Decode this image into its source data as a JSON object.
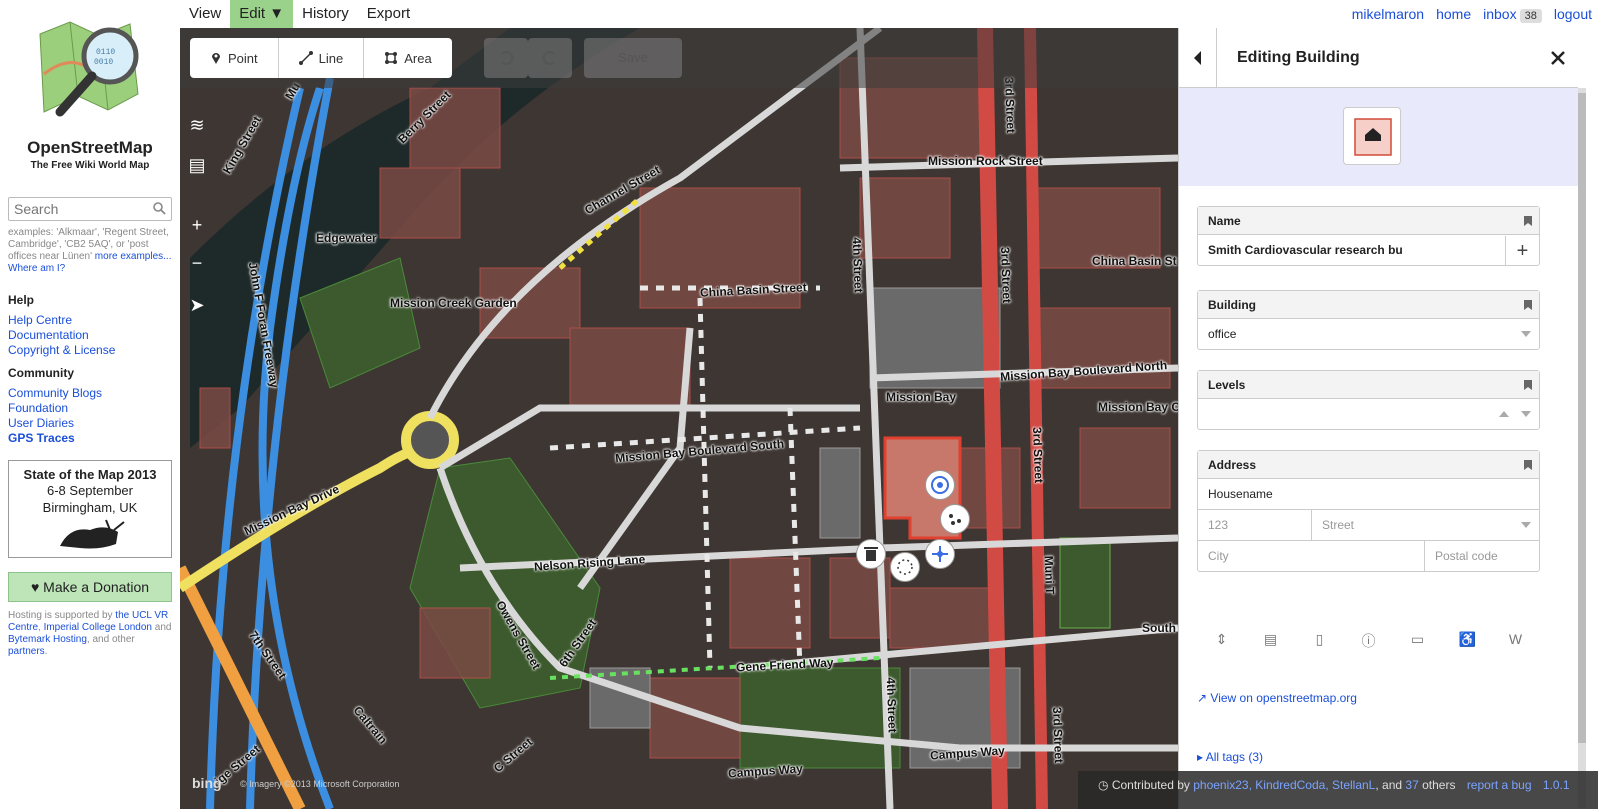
{
  "brand": {
    "name": "OpenStreetMap",
    "tagline": "The Free Wiki World Map"
  },
  "search": {
    "placeholder": "Search"
  },
  "examples": {
    "text": "examples: 'Alkmaar', 'Regent Street, Cambridge', 'CB2 5AQ', or 'post offices near Lünen'",
    "more": "more examples...",
    "where": "Where am I?"
  },
  "help": {
    "title": "Help",
    "items": [
      "Help Centre",
      "Documentation",
      "Copyright & License"
    ]
  },
  "community": {
    "title": "Community",
    "items": [
      "Community Blogs",
      "Foundation",
      "User Diaries",
      "GPS Traces"
    ]
  },
  "sotm": {
    "title": "State of the Map 2013",
    "date": "6-8 September",
    "place": "Birmingham, UK"
  },
  "donation": {
    "label": "Make a Donation"
  },
  "hosting": {
    "prefix": "Hosting is supported by",
    "ucl": "the UCL VR Centre",
    "imperial": "Imperial College London",
    "and": "and",
    "bytemark": "Bytemark Hosting",
    "other": ", and other",
    "partners": "partners",
    "end": "."
  },
  "nav": {
    "view": "View",
    "edit": "Edit ▼",
    "history": "History",
    "export": "Export"
  },
  "user": {
    "name": "mikelmaron",
    "home": "home",
    "inbox": "inbox",
    "inbox_count": "38",
    "logout": "logout"
  },
  "modes": {
    "point": "Point",
    "line": "Line",
    "area": "Area",
    "save": "Save"
  },
  "map_labels": {
    "mission_rock": "Mission Rock Street",
    "china_basin": "China Basin Street",
    "china_basin2": "China Basin St",
    "mission_bay": "Mission Bay",
    "mbb_south": "Mission Bay Boulevard South",
    "mbb_north": "Mission Bay Boulevard North",
    "mission_bay_c": "Mission Bay C",
    "nelson": "Nelson Rising Lane",
    "gene": "Gene Friend Way",
    "campus1": "Campus Way",
    "campus2": "Campus Way",
    "owens": "Owens Street",
    "sixth": "6th Street",
    "fourth1": "4th Street",
    "fourth2": "4th Street",
    "third1": "3rd Street",
    "third2": "3rd Street",
    "third3": "3rd Street",
    "third4": "3rd Street",
    "muni": "Muni T",
    "south": "South",
    "seventh": "7th Street",
    "caltrain": "Caltrain",
    "mbdrive": "Mission Bay Drive",
    "cstreet": "C Street",
    "mcgarden": "Mission Creek Garden",
    "edgewater": "Edgewater",
    "channel": "Channel Street",
    "berry": "Berry Street",
    "king": "King Street",
    "jfs": "John F Foran Freeway",
    "mu": "Mu",
    "ige": "ige Street"
  },
  "map_attrib": {
    "bing": "bing",
    "text": "© Imagery ©2013 Microsoft Corporation"
  },
  "inspector": {
    "title": "Editing Building",
    "name_label": "Name",
    "name_value": "Smith Cardiovascular research bu",
    "building_label": "Building",
    "building_value": "office",
    "levels_label": "Levels",
    "address_label": "Address",
    "housename": "Housename",
    "housenumber": "123",
    "street": "Street",
    "city": "City",
    "postcode": "Postal code",
    "view_link": "View on openstreetmap.org",
    "all_tags": "▸ All tags (3)"
  },
  "footer": {
    "contributed": "Contributed by",
    "contributors": "phoenix23, KindredCoda, StellanL",
    "and": ", and",
    "count": "37",
    "others": "others",
    "report": "report a bug",
    "version": "1.0.1"
  },
  "colors": {
    "active_tab": "#9ad28b",
    "link": "#1a4fd8",
    "preset_bg": "#e8eafc",
    "building_fill": "#b0584e"
  }
}
